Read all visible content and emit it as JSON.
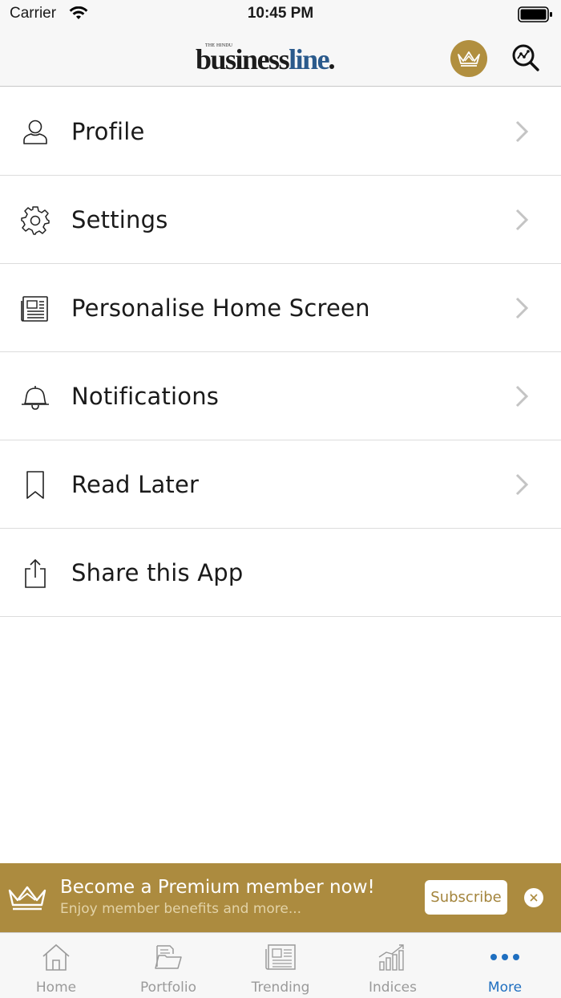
{
  "status_bar": {
    "carrier": "Carrier",
    "time": "10:45 PM"
  },
  "header": {
    "logo_top": "THE HINDU",
    "logo_part1": "business",
    "logo_part2": "line"
  },
  "menu": {
    "items": [
      {
        "label": "Profile",
        "icon": "user-icon",
        "chevron": true
      },
      {
        "label": "Settings",
        "icon": "gear-icon",
        "chevron": true
      },
      {
        "label": "Personalise Home Screen",
        "icon": "newspaper-icon",
        "chevron": true
      },
      {
        "label": "Notifications",
        "icon": "bell-icon",
        "chevron": true
      },
      {
        "label": "Read Later",
        "icon": "bookmark-icon",
        "chevron": true
      },
      {
        "label": "Share this App",
        "icon": "share-icon",
        "chevron": false
      }
    ]
  },
  "banner": {
    "title": "Become a Premium member now!",
    "subtitle": "Enjoy member benefits and more...",
    "subscribe_label": "Subscribe"
  },
  "tab_bar": {
    "tabs": [
      {
        "label": "Home",
        "icon": "home-icon"
      },
      {
        "label": "Portfolio",
        "icon": "portfolio-icon"
      },
      {
        "label": "Trending",
        "icon": "trending-icon"
      },
      {
        "label": "Indices",
        "icon": "indices-icon"
      },
      {
        "label": "More",
        "icon": "more-icon",
        "active": true
      }
    ]
  },
  "colors": {
    "gold": "#ac8b3f",
    "active_tab": "#1f6fc0",
    "inactive_tab": "#9a9a9a"
  }
}
